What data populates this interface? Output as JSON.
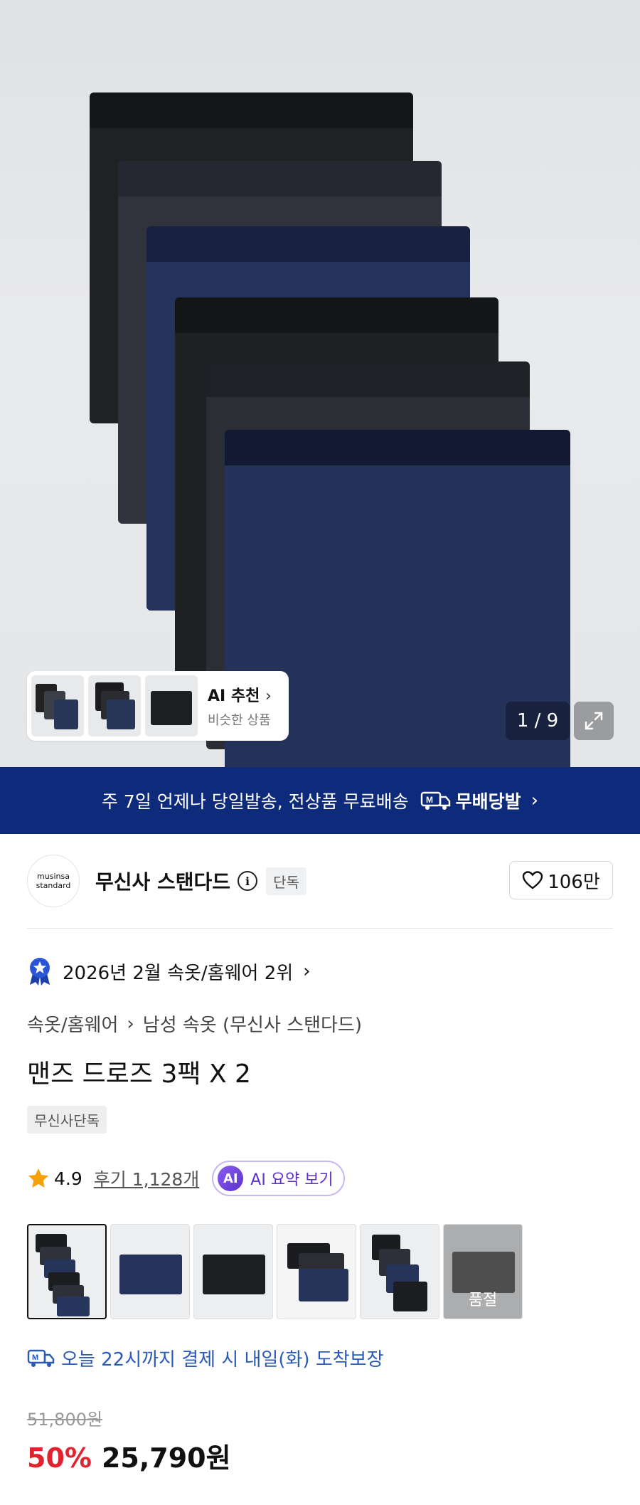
{
  "hero": {
    "ai_card": {
      "title": "AI 추천",
      "subtitle": "비슷한 상품"
    },
    "image_counter": "1 / 9"
  },
  "banner": {
    "text": "주 7일 언제나 당일발송, 전상품 무료배송",
    "badge": "무배당발"
  },
  "brand": {
    "logo_line1": "musinsa",
    "logo_line2": "standard",
    "name": "무신사 스탠다드",
    "exclusive_badge": "단독",
    "likes": "106만"
  },
  "rank": {
    "text": "2026년 2월 속옷/홈웨어 2위"
  },
  "breadcrumb": {
    "category": "속옷/홈웨어",
    "subcategory": "남성 속옷 (무신사 스탠다드)"
  },
  "product": {
    "title": "맨즈 드로즈 3팩 X 2",
    "exclusive_tag": "무신사단독",
    "rating": "4.9",
    "review_link": "후기 1,128개",
    "ai_summary": "AI 요약 보기",
    "ai_badge": "AI"
  },
  "color_options": [
    {
      "id": "opt-1",
      "selected": true,
      "soldout": false
    },
    {
      "id": "opt-2",
      "selected": false,
      "soldout": false
    },
    {
      "id": "opt-3",
      "selected": false,
      "soldout": false
    },
    {
      "id": "opt-4",
      "selected": false,
      "soldout": false
    },
    {
      "id": "opt-5",
      "selected": false,
      "soldout": false
    },
    {
      "id": "opt-6",
      "selected": false,
      "soldout": true
    }
  ],
  "soldout_label": "품절",
  "delivery": {
    "text": "오늘 22시까지 결제 시 내일(화) 도착보장"
  },
  "price": {
    "original": "51,800원",
    "discount": "50%",
    "final": "25,790원"
  },
  "colors": {
    "banner_bg": "#0e2a7a",
    "discount_red": "#e0242f",
    "delivery_blue": "#2a5ab8",
    "ai_purple": "#5b31c9"
  }
}
